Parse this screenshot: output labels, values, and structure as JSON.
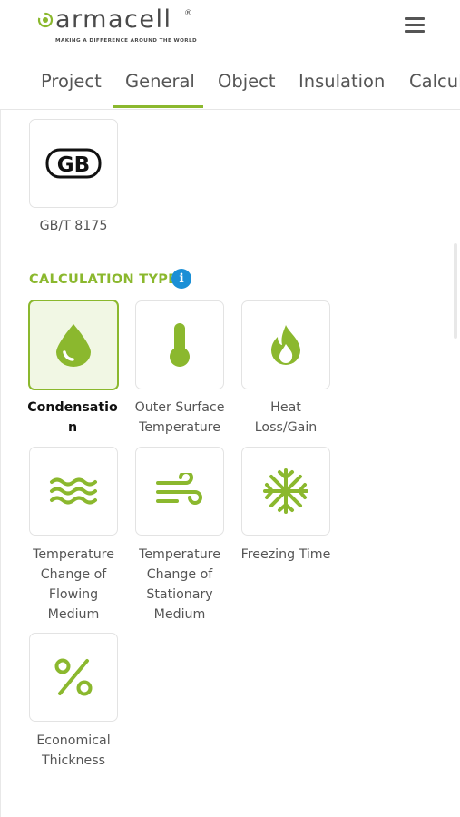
{
  "brand": {
    "name": "armacell",
    "registered": "®",
    "tagline": "MAKING A DIFFERENCE AROUND THE WORLD"
  },
  "tabs": [
    {
      "label": "Project"
    },
    {
      "label": "General"
    },
    {
      "label": "Object"
    },
    {
      "label": "Insulation"
    },
    {
      "label": "Calcula"
    }
  ],
  "active_tab": "General",
  "standard": {
    "logo_text": "GB",
    "label": "GB/T 8175"
  },
  "calculation_type": {
    "title": "CALCULATION TYPE",
    "info_icon": "i",
    "options": [
      {
        "label_line1": "Condensatio",
        "label_line2": "n",
        "icon": "droplet-icon",
        "selected": true
      },
      {
        "label_line1": "Outer Surface",
        "label_line2": "Temperature",
        "icon": "thermometer-icon",
        "selected": false
      },
      {
        "label_line1": "Heat",
        "label_line2": "Loss/Gain",
        "icon": "flame-icon",
        "selected": false
      },
      {
        "label_line1": "Temperature",
        "label_line2": "Change of",
        "label_line3": "Flowing",
        "label_line4": "Medium",
        "icon": "waves-icon",
        "selected": false
      },
      {
        "label_line1": "Temperature",
        "label_line2": "Change of",
        "label_line3": "Stationary",
        "label_line4": "Medium",
        "icon": "wind-icon",
        "selected": false
      },
      {
        "label_line1": "Freezing Time",
        "icon": "snowflake-icon",
        "selected": false
      },
      {
        "label_line1": "Economical",
        "label_line2": "Thickness",
        "icon": "percent-icon",
        "selected": false
      }
    ]
  },
  "colors": {
    "accent": "#8bb82e",
    "info": "#1a8fd6",
    "text": "#555555"
  }
}
